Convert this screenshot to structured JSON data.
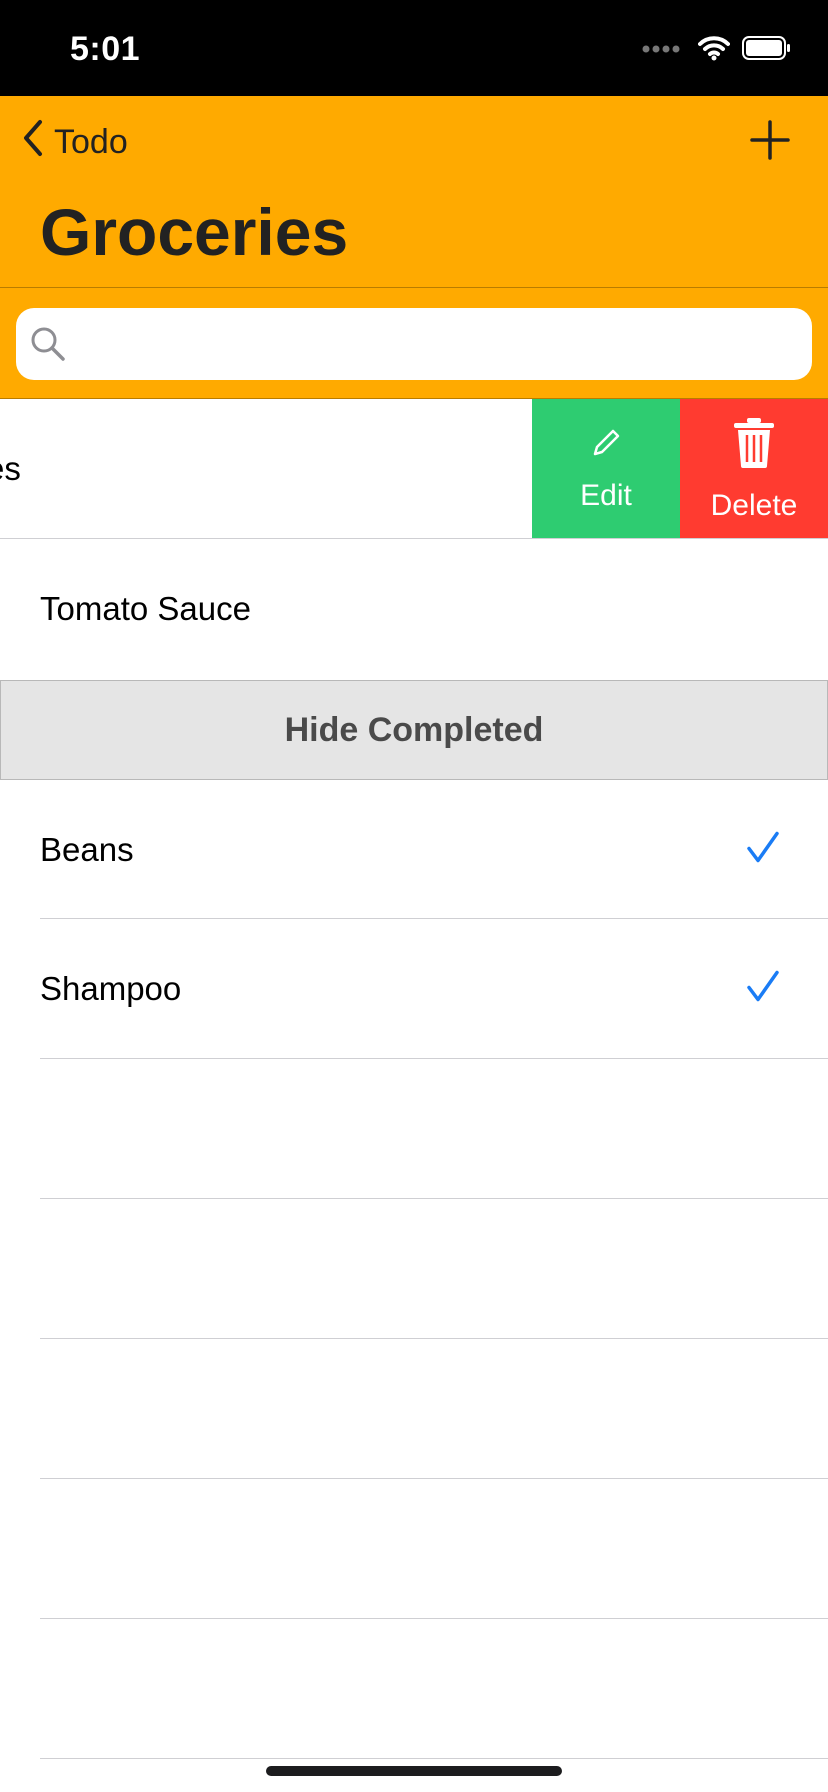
{
  "status_bar": {
    "time": "5:01"
  },
  "nav": {
    "back_label": "Todo",
    "title": "Groceries"
  },
  "search": {
    "placeholder": "",
    "value": ""
  },
  "swiped_row": {
    "partial_label": "es",
    "actions": [
      {
        "label": "Edit",
        "icon": "pencil-icon",
        "color": "#2ECC71"
      },
      {
        "label": "Delete",
        "icon": "trash-icon",
        "color": "#FF3B30"
      }
    ]
  },
  "rows": [
    {
      "label": "Tomato Sauce",
      "checked": false
    }
  ],
  "hide_completed_label": "Hide Completed",
  "completed_rows": [
    {
      "label": "Beans",
      "checked": true
    },
    {
      "label": "Shampoo",
      "checked": true
    }
  ],
  "colors": {
    "accent": "#FFAA00",
    "check": "#1A7CF5"
  }
}
